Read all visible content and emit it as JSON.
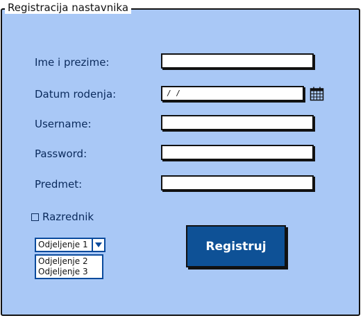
{
  "form": {
    "title": "Registracija nastavnika",
    "fields": [
      {
        "label": "Ime i prezime:",
        "value": ""
      },
      {
        "label": "Datum rodenja:",
        "value": " / /"
      },
      {
        "label": "Username:",
        "value": ""
      },
      {
        "label": "Password:",
        "value": ""
      },
      {
        "label": "Predmet:",
        "value": ""
      }
    ],
    "checkbox_label": "Razrednik",
    "checkbox_checked": false,
    "combo_selected": "Odjeljenje 1",
    "combo_options": [
      "Odjeljenje 2",
      "Odjeljenje 3"
    ],
    "submit_label": "Registruj"
  },
  "icons": {
    "calendar": "calendar-icon",
    "combo_arrow": "chevron-down-icon"
  },
  "colors": {
    "panel_background": "#a9c8f6",
    "label_text": "#0a2a5c",
    "button_background": "#0e5196",
    "combo_border": "#0a4a9c"
  }
}
